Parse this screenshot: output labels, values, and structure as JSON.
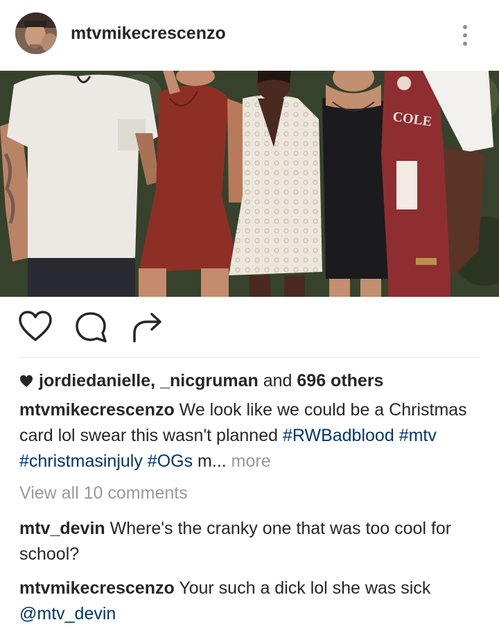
{
  "post": {
    "username": "mtvmikecrescenzo"
  },
  "photo": {
    "jersey_text": "COLE"
  },
  "likes": {
    "user1": "jordiedanielle",
    "sep": ", ",
    "user2": "_nicgruman",
    "and": " and ",
    "others": "696 others"
  },
  "caption": {
    "username": "mtvmikecrescenzo",
    "text": " We look like we could be a Christmas card lol swear this wasn't planned ",
    "hashtags": [
      "#RWBadblood",
      "#mtv",
      "#christmasinjuly",
      "#OGs"
    ],
    "truncated": "m...",
    "more": "more"
  },
  "view_all": "View all 10 comments",
  "comments": [
    {
      "username": "mtv_devin",
      "text": " Where's the cranky one that was too cool for school?"
    },
    {
      "username": "mtvmikecrescenzo",
      "text": " Your such a dick lol she was sick ",
      "mention": "@mtv_devin"
    }
  ],
  "icons": {
    "like": "heart-outline-icon",
    "comment": "speech-bubble-icon",
    "share": "share-arrow-icon",
    "options": "vertical-dots-icon",
    "likes_heart": "filled-heart-icon"
  },
  "colors": {
    "text": "#262626",
    "hashtag": "#003569",
    "muted": "#999999"
  }
}
